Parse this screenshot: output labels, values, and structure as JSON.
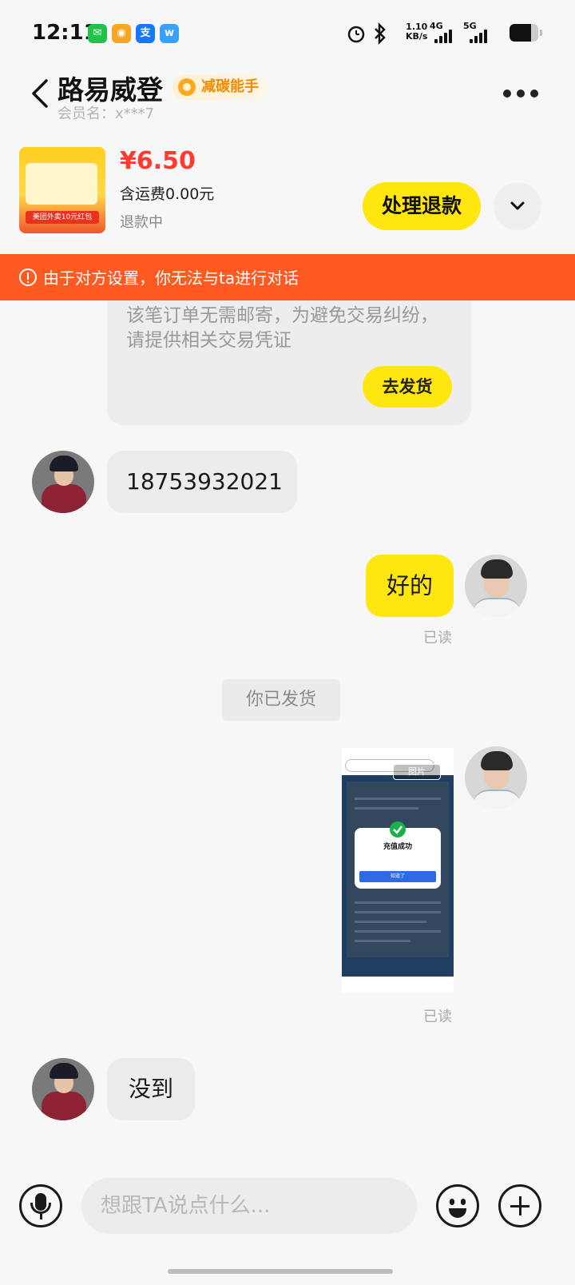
{
  "status_bar": {
    "time": "12:11",
    "net_speed": "1.10",
    "net_unit": "KB/s",
    "signal1": "4G",
    "signal2": "5G",
    "battery_level": 0.75,
    "icons": [
      "wechat-icon",
      "weibo-icon",
      "alipay-icon",
      "app-icon",
      "alarm-icon",
      "bluetooth-icon"
    ]
  },
  "header": {
    "name": "路易威登",
    "badge": "减碳能手",
    "member": "会员名：x***7"
  },
  "product": {
    "price": "¥6.50",
    "shipping": "含运费0.00元",
    "status": "退款中",
    "refund_button": "处理退款",
    "thumb_text": "美团外卖10元红包"
  },
  "banner": {
    "text": "由于对方设置，你无法与ta进行对话"
  },
  "messages": {
    "system_card_text": "该笔订单无需邮寄，为避免交易纠纷，请提供相关交易凭证",
    "ship_button": "去发货",
    "phone": "18753932021",
    "reply_ok": "好的",
    "read1": "已读",
    "shipped_notice": "你已发货",
    "image_label": "图片",
    "image_dialog_title": "充值成功",
    "image_dialog_button": "知道了",
    "read2": "已读",
    "not_arrived": "没到"
  },
  "input": {
    "placeholder": "想跟TA说点什么..."
  },
  "colors": {
    "accent_yellow": "#ffe60f",
    "banner_orange": "#ff5a22",
    "price_red": "#ff3b2f"
  }
}
